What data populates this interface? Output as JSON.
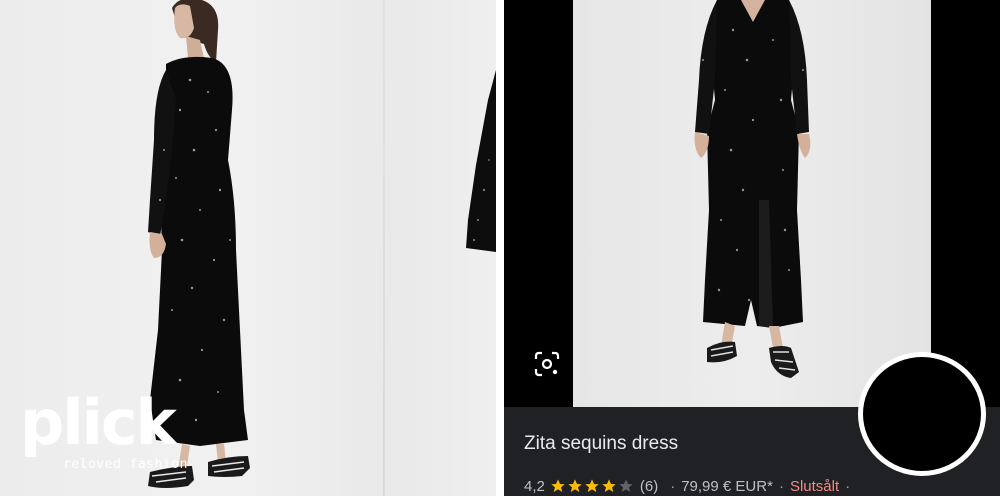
{
  "left_photo": {
    "logo": {
      "word": "plick",
      "tagline": "reloved fashion"
    }
  },
  "right_screenshot": {
    "icons": {
      "lens": "google-lens-icon",
      "star": "star-icon"
    },
    "product": {
      "title": "Zita sequins dress",
      "rating": "4,2",
      "stars_filled": 4,
      "stars_total": 5,
      "review_count": "(6)",
      "separator": "·",
      "price": "79,99 € EUR*",
      "availability": "Slutsålt",
      "trailing_separator": "·"
    },
    "colors": {
      "info_bar_bg": "#202124",
      "title_text": "#e8eaed",
      "star_filled": "#fbbc04",
      "star_empty": "#5f6368",
      "sold_out": "#f28b82"
    }
  }
}
